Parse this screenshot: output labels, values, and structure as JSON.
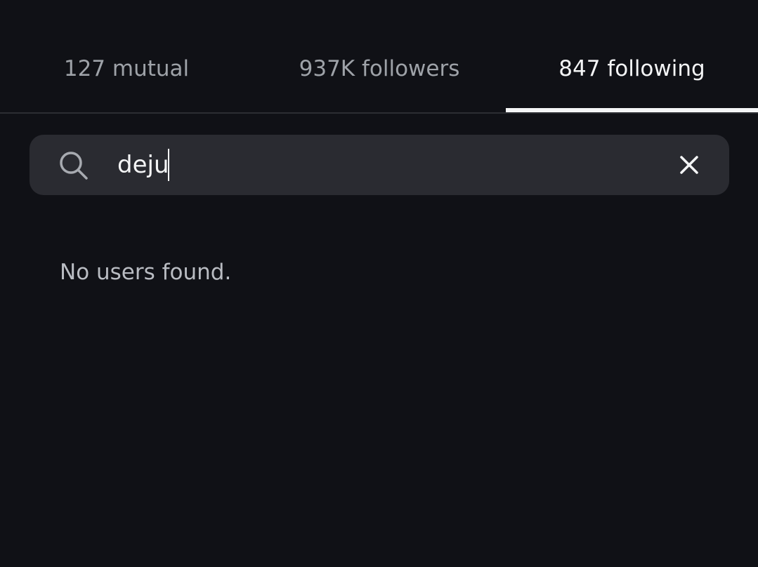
{
  "tabs": [
    {
      "label": "127 mutual",
      "active": false
    },
    {
      "label": "937K followers",
      "active": false
    },
    {
      "label": "847 following",
      "active": true
    }
  ],
  "search": {
    "value": "deju",
    "icon": "search-icon",
    "clear_icon": "close-icon"
  },
  "results": {
    "empty_message": "No users found."
  },
  "colors": {
    "background": "#101116",
    "search_background": "#2a2b31",
    "active_tab": "#f4f5f6",
    "inactive_tab": "#9ea2a8"
  }
}
